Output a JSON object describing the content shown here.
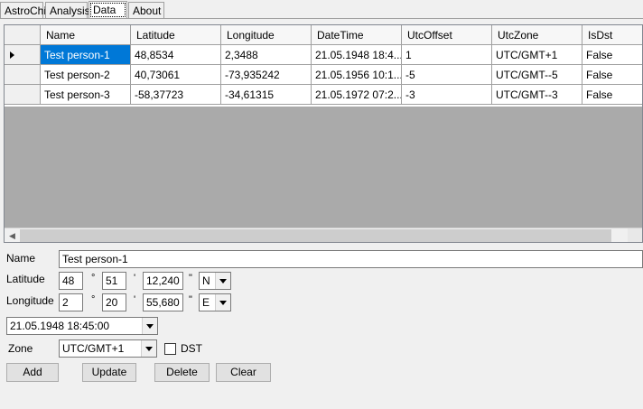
{
  "tabs": [
    "AstroChi",
    "Analysis",
    "Data",
    "About"
  ],
  "grid": {
    "columns": [
      "Name",
      "Latitude",
      "Longitude",
      "DateTime",
      "UtcOffset",
      "UtcZone",
      "IsDst"
    ],
    "rows": [
      [
        "Test person-1",
        "48,8534",
        "2,3488",
        "21.05.1948 18:4...",
        "1",
        "UTC/GMT+1",
        "False"
      ],
      [
        "Test person-2",
        "40,73061",
        "-73,935242",
        "21.05.1956 10:1...",
        "-5",
        "UTC/GMT--5",
        "False"
      ],
      [
        "Test person-3",
        "-58,37723",
        "-34,61315",
        "21.05.1972 07:2...",
        "-3",
        "UTC/GMT--3",
        "False"
      ]
    ]
  },
  "form": {
    "name_label": "Name",
    "name_value": "Test person-1",
    "latitude_label": "Latitude",
    "lat_deg": "48",
    "lat_min": "51",
    "lat_sec": "12,240",
    "lat_dir": "N",
    "longitude_label": "Longitude",
    "lon_deg": "2",
    "lon_min": "20",
    "lon_sec": "55,680",
    "lon_dir": "E",
    "datetime": "21.05.1948 18:45:00",
    "zone_label": "Zone",
    "zone_value": "UTC/GMT+1",
    "dst_label": "DST",
    "deg_symbol": "°",
    "min_symbol": "'",
    "sec_symbol": "\""
  },
  "buttons": {
    "add": "Add",
    "update": "Update",
    "delete": "Delete",
    "clear": "Clear"
  }
}
